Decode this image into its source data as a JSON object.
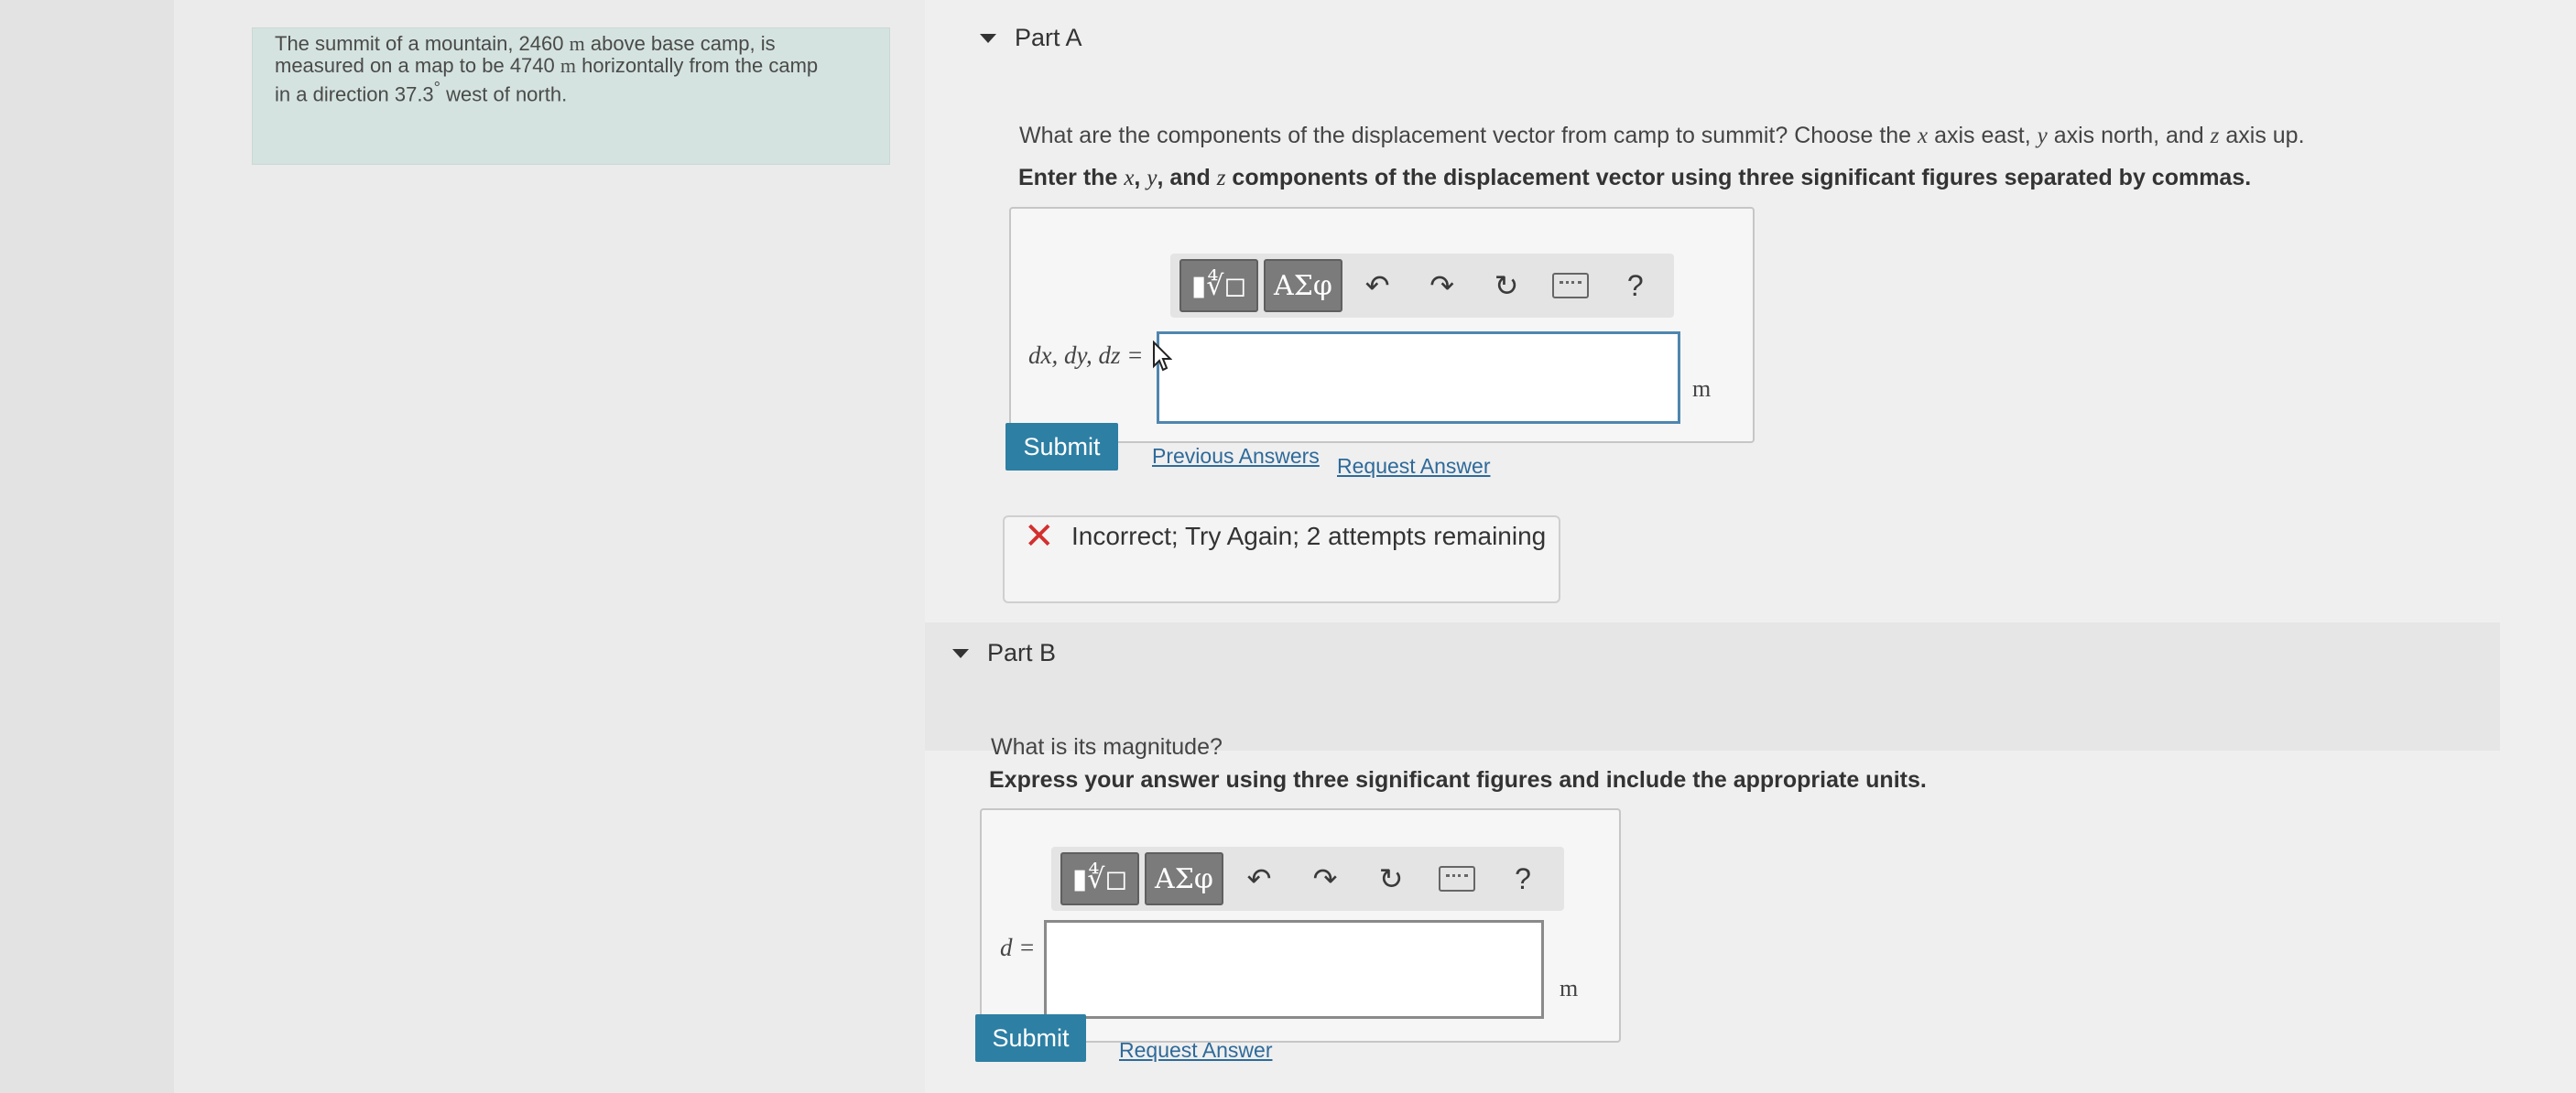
{
  "problem": {
    "pre_a": "The summit of a mountain, 2460",
    "unit_a": "m",
    "mid_a": "above base camp, is",
    "line2_pre": "measured on a map to be 4740",
    "unit_b": "m",
    "line2_post": "horizontally from the camp",
    "line3_pre": "in a direction 37.3",
    "degree": "°",
    "line3_post": "west of north."
  },
  "part_a": {
    "header": "Part A",
    "question_pre": "What are the components of the displacement vector from camp to summit? Choose the",
    "var_x": "x",
    "q_mid1": "axis east,",
    "var_y": "y",
    "q_mid2": "axis north, and",
    "var_z": "z",
    "q_post": "axis up.",
    "instr_pre": "Enter the",
    "instr_x": "x",
    "instr_sep1": ",",
    "instr_y": "y",
    "instr_sep2": ", and",
    "instr_z": "z",
    "instr_post": "components of the displacement vector using three significant figures separated by commas.",
    "answer_label": "dx, dy, dz =",
    "unit": "m",
    "submit_label": "Submit",
    "previous_answers_label": "Previous Answers",
    "request_answer_label": "Request Answer",
    "feedback_text": "Incorrect; Try Again; 2 attempts remaining"
  },
  "part_b": {
    "header": "Part B",
    "question": "What is its magnitude?",
    "instr": "Express your answer using three significant figures and include the appropriate units.",
    "answer_label": "d =",
    "unit": "m",
    "submit_label": "Submit",
    "request_answer_label": "Request Answer"
  },
  "toolbar": {
    "templates_glyph": "▮∜◻",
    "greek_label": "ΑΣφ",
    "undo_glyph": "↶",
    "redo_glyph": "↷",
    "reset_glyph": "↻",
    "help_label": "?"
  },
  "colors": {
    "submit_bg": "#2d7fa4",
    "incorrect_red": "#d32f2f",
    "problem_bg": "#d4e3df",
    "link": "#2e6a9a"
  }
}
